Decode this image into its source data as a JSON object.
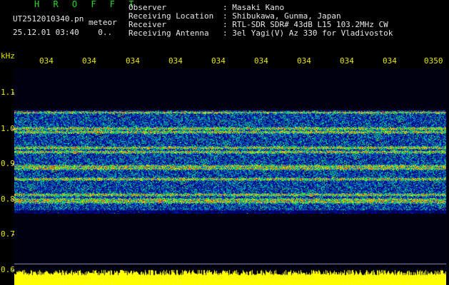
{
  "header": {
    "brand": "H R O F F T",
    "filename": "UT2512010340.pn",
    "tag": "meteor",
    "timestamp": "25.12.01 03:40    0..",
    "labels": "Observer\nReceiving Location\nReceiver\nReceiving Antenna",
    "values": ": Masaki Kano\n: Shibukawa, Gunma, Japan\n: RTL-SDR SDR# 43dB L15 103.2MHz CW\n: 3el Yagi(V) Az 330 for Vladivostok"
  },
  "axes": {
    "y_unit": "kHz",
    "x_ticks": [
      "034",
      "034",
      "034",
      "034",
      "034",
      "034",
      "034",
      "034",
      "034",
      "0350"
    ],
    "y_ticks": [
      "1.1",
      "1.0",
      "0.9",
      "0.8",
      "0.7",
      "0.6"
    ]
  },
  "colors": {
    "header_label": "#e8e8e8",
    "brand": "#22dd22",
    "ticks": "#e6e600",
    "noise_bar": "#ffff00",
    "spectrogram_base": "#0000a0",
    "spectrogram_hot": "#ff4000"
  }
}
